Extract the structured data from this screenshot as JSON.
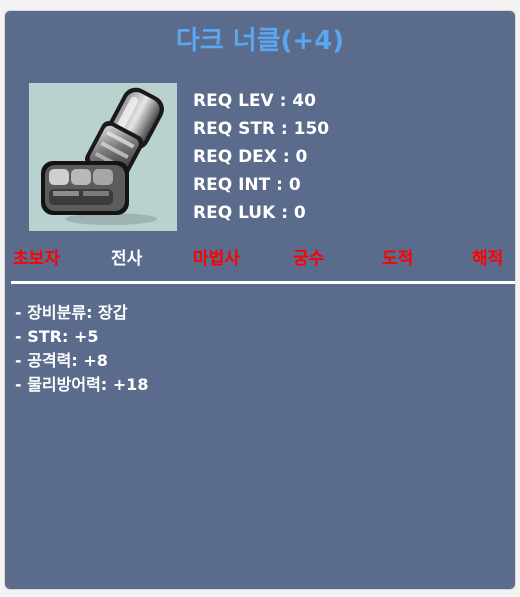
{
  "item": {
    "name": "다크 너클(+4)",
    "icon": "dark-knuckle-glove-icon",
    "colors": {
      "panel": "#5b6b8c",
      "title": "#5aa6ef",
      "text": "#ffffff",
      "unavailable_job": "#ff0000",
      "available_job": "#ffffff",
      "icon_background": "#b9d2d0"
    }
  },
  "requirements": [
    "REQ LEV : 40",
    "REQ STR : 150",
    "REQ DEX : 0",
    "REQ INT : 0",
    "REQ LUK : 0"
  ],
  "jobs": [
    {
      "label": "초보자",
      "available": false
    },
    {
      "label": "전사",
      "available": true
    },
    {
      "label": "마법사",
      "available": false
    },
    {
      "label": "궁수",
      "available": false
    },
    {
      "label": "도적",
      "available": false
    },
    {
      "label": "해적",
      "available": false
    }
  ],
  "description": [
    "- 장비분류: 장갑",
    "- STR: +5",
    "- 공격력: +8",
    "- 물리방어력: +18"
  ]
}
